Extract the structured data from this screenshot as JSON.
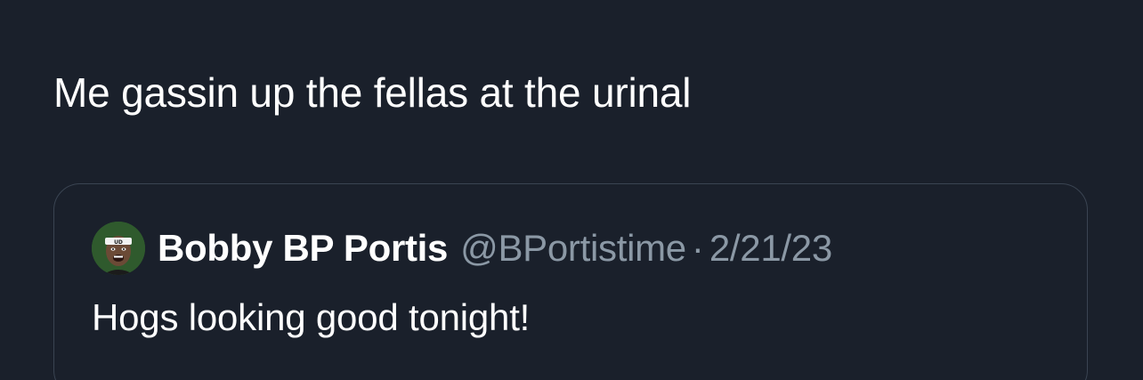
{
  "tweet": {
    "text": "Me gassin up the fellas at the urinal"
  },
  "quoted_tweet": {
    "author_name": "Bobby BP Portis",
    "author_handle": "@BPortistime",
    "separator": "·",
    "date": "2/21/23",
    "text": "Hogs looking good tonight!",
    "avatar_icon": "profile-avatar-icon"
  },
  "colors": {
    "background": "#1a202b",
    "text_primary": "#ffffff",
    "text_secondary": "#8b98a5",
    "card_border": "#3a4452",
    "avatar_bg": "#2f5a2d"
  }
}
